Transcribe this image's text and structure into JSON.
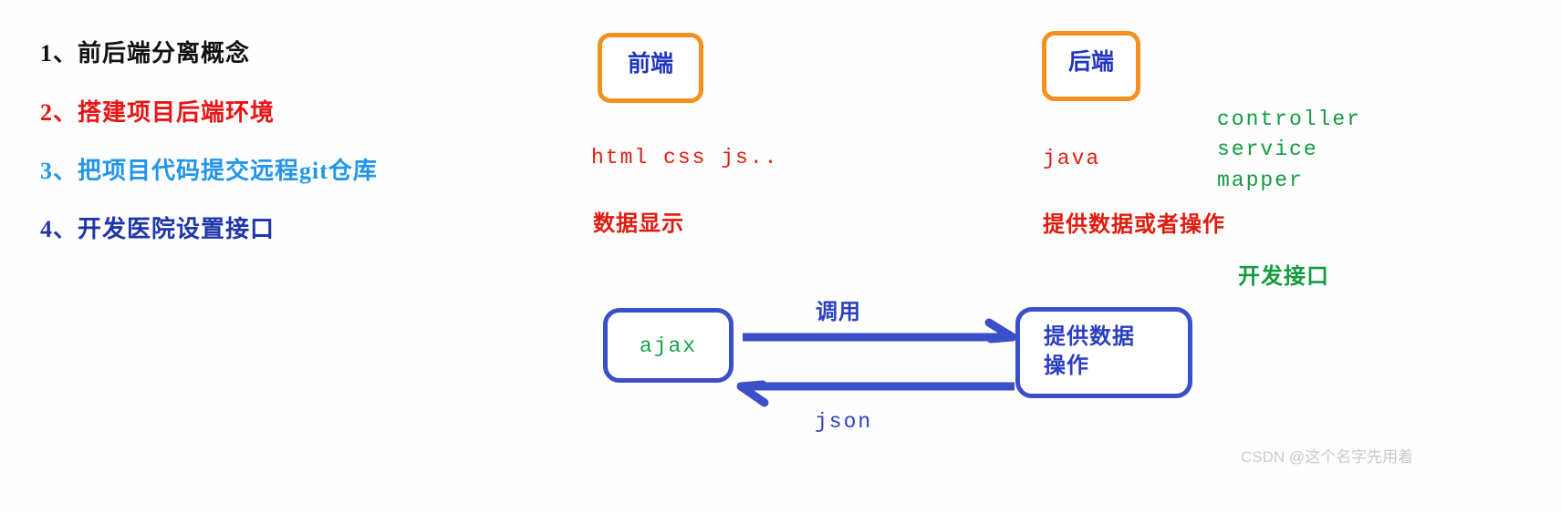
{
  "outline": {
    "items": [
      {
        "text": "1、前后端分离概念",
        "color": "#111111"
      },
      {
        "text": "2、搭建项目后端环境",
        "color": "#e81414"
      },
      {
        "text": "3、把项目代码提交远程git仓库",
        "color": "#2196e8"
      },
      {
        "text": "4、开发医院设置接口",
        "color": "#1f35a8"
      }
    ]
  },
  "frontend": {
    "box_label": "前端",
    "tech": "html css js..",
    "role": "数据显示"
  },
  "backend": {
    "box_label": "后端",
    "tech": "java",
    "role": "提供数据或者操作",
    "layers": [
      "controller",
      "service",
      "mapper"
    ],
    "dev_api": "开发接口"
  },
  "flow": {
    "client_label": "ajax",
    "server_label_line1": "提供数据",
    "server_label_line2": "操作",
    "request_label": "调用",
    "response_label": "json"
  },
  "watermark": "CSDN @这个名字先用着",
  "colors": {
    "orange_border": "#f5901f",
    "blue_border": "#3a4fc8",
    "red_text": "#e01b0d",
    "green_text": "#139b3f",
    "blue_text": "#2b3fc2"
  }
}
